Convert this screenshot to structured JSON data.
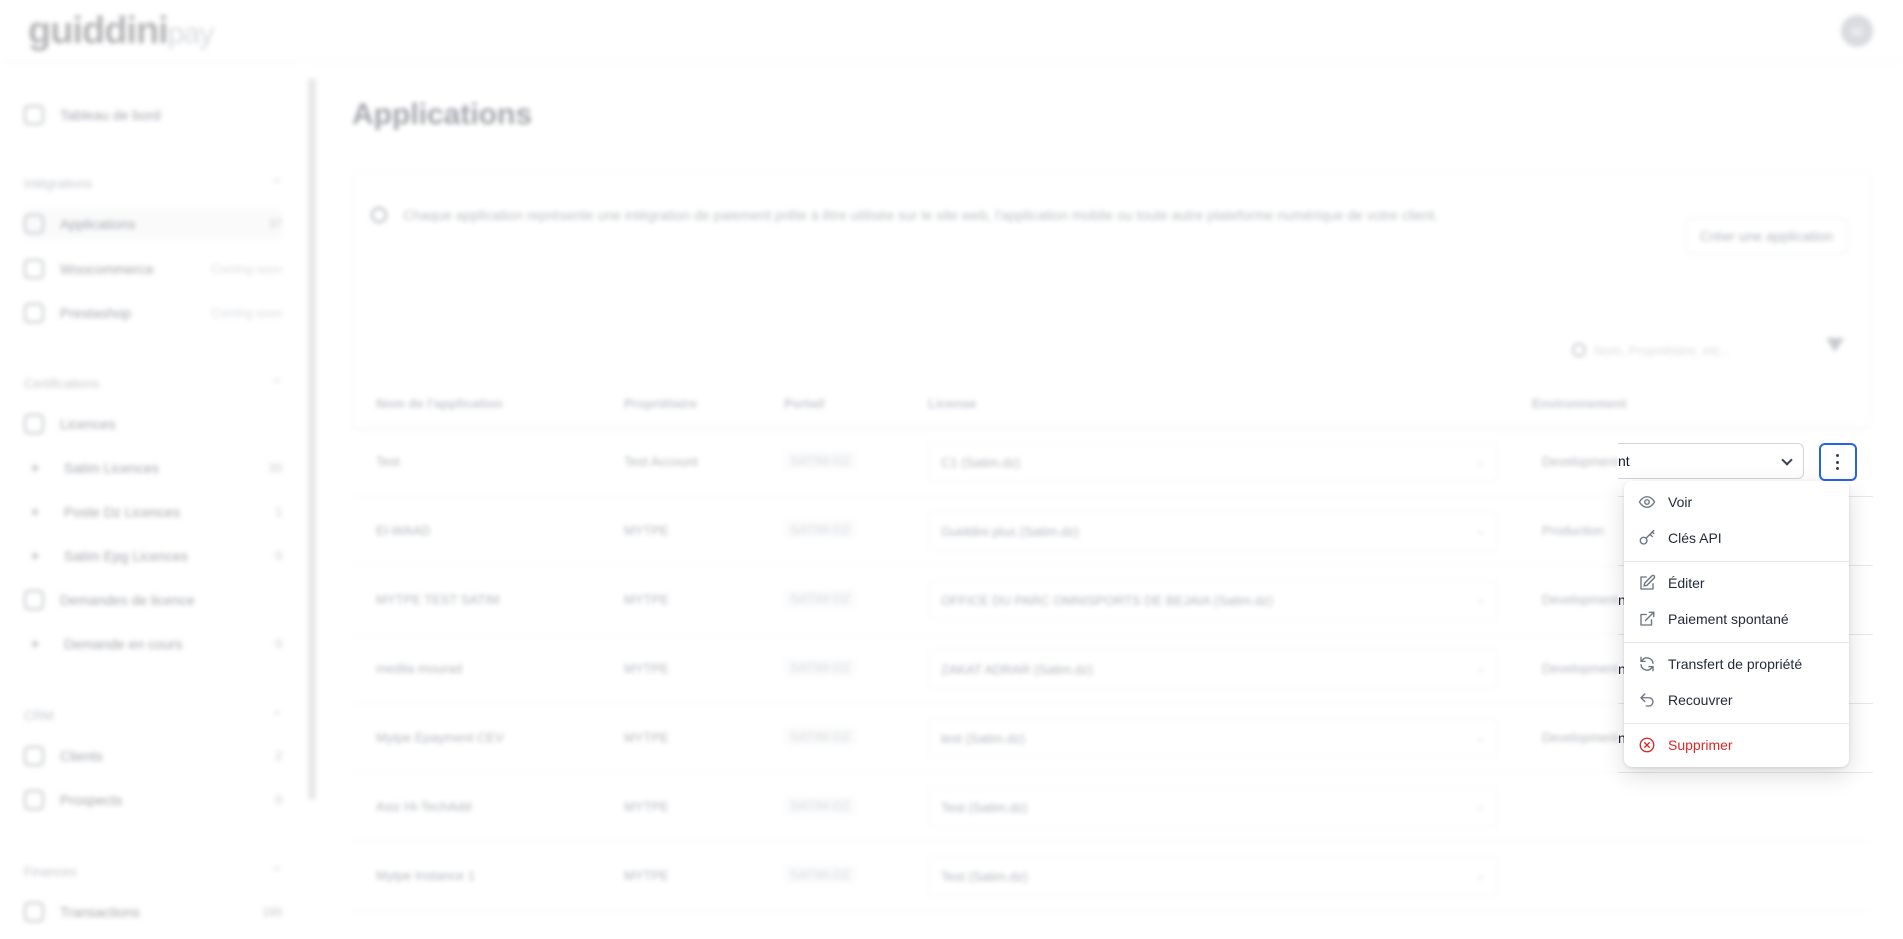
{
  "brand": {
    "logo_main": "guiddini",
    "logo_pay": "pay"
  },
  "user": {
    "avatar_initial": "M"
  },
  "sidebar": {
    "dashboard": {
      "label": "Tableau de bord"
    },
    "group_integrations": "Intégrations",
    "applications": {
      "label": "Applications",
      "count": "37"
    },
    "woocommerce": {
      "label": "Woocommerce",
      "badge": "Coming soon"
    },
    "prestashop": {
      "label": "Prestashop",
      "badge": "Coming soon"
    },
    "group_certifications": "Certifications",
    "licences": {
      "label": "Licences"
    },
    "satim_licences": {
      "label": "Satim Licences",
      "count": "30"
    },
    "poste_dz_licences": {
      "label": "Poste Dz Licences",
      "count": "1"
    },
    "satim_epg_licences": {
      "label": "Satim Epg Licences",
      "count": "0"
    },
    "demandes_licence": {
      "label": "Demandes de licence"
    },
    "demande_en_cours": {
      "label": "Demande en cours",
      "count": "0"
    },
    "group_crm": "CRM",
    "clients": {
      "label": "Clients",
      "count": "2"
    },
    "prospects": {
      "label": "Prospects",
      "count": "0"
    },
    "group_finances": "Finances",
    "transactions": {
      "label": "Transactions",
      "count": "186"
    }
  },
  "main": {
    "title": "Applications",
    "info": "Chaque application représente une intégration de paiement prête à être utilisée sur le site web, l'application mobile ou toute autre plateforme numérique de votre client.",
    "create_button": "Créer une application",
    "search_placeholder": "Nom, Propriétaire, etc...",
    "filter_count": "0",
    "columns": [
      "Nom de l'application",
      "Propriétaire",
      "Portail",
      "License",
      "Environnement"
    ],
    "rows": [
      {
        "name": "Test",
        "owner": "Test Account",
        "portal": "SATIM-DZ",
        "license": "C1 (Satim.dz)",
        "env": "Development"
      },
      {
        "name": "El-WAAD",
        "owner": "MYTPE",
        "portal": "SATIM-DZ",
        "license": "Guiddini plus (Satim.dz)",
        "env": "Production"
      },
      {
        "name": "MYTPE TEST SATIM",
        "owner": "MYTPE",
        "portal": "SATIM-DZ",
        "license": "OFFICE DU PARC OMNISPORTS DE BEJAIA (Satim.dz)",
        "env": "Development"
      },
      {
        "name": "medila mourad",
        "owner": "MYTPE",
        "portal": "SATIM-DZ",
        "license": "ZAKAT ADRAR (Satim.dz)",
        "env": "Development"
      },
      {
        "name": "Mytpe Epayment CEV",
        "owner": "MYTPE",
        "portal": "SATIM-DZ",
        "license": "test (Satim.dz)",
        "env": "Development"
      },
      {
        "name": "Asiz Hi-TechAdd",
        "owner": "MYTPE",
        "portal": "SATIM-DZ",
        "license": "Test (Satim.dz)",
        "env": ""
      },
      {
        "name": "Mytpe Instance 1",
        "owner": "MYTPE",
        "portal": "SATIM-DZ",
        "license": "Test (Satim.dz)",
        "env": ""
      }
    ]
  },
  "row_controls": {
    "env_value_visible": "nt",
    "peek_texts": [
      "nt",
      "nt",
      "nt"
    ]
  },
  "dropdown_menu": {
    "items": [
      {
        "label": "Voir",
        "icon": "eye-icon"
      },
      {
        "label": "Clés API",
        "icon": "key-icon"
      },
      {
        "label": "Éditer",
        "icon": "edit-icon"
      },
      {
        "label": "Paiement spontané",
        "icon": "external-link-icon"
      },
      {
        "label": "Transfert de propriété",
        "icon": "refresh-icon"
      },
      {
        "label": "Recouvrer",
        "icon": "undo-icon"
      },
      {
        "label": "Supprimer",
        "icon": "x-circle-icon"
      }
    ],
    "danger_color": "#dc2626"
  },
  "colors": {
    "focus_ring": "#2563eb",
    "text": "#1f2937",
    "muted": "#6b7280"
  }
}
